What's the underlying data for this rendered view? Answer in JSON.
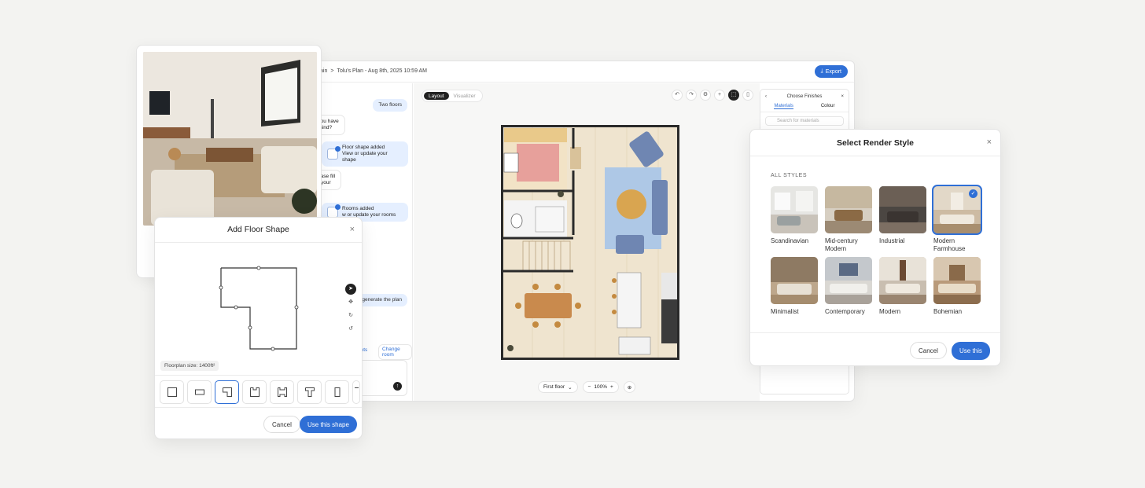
{
  "app": {
    "breadcrumb": [
      "ain",
      ">",
      "Tolu's Plan - Aug 8th, 2025 10:59 AM"
    ],
    "export_label": "Export",
    "chat": {
      "messages": [
        {
          "role": "user",
          "text": "Two floors"
        },
        {
          "role": "ai",
          "text": "o you have\ne mind?"
        },
        {
          "role": "card",
          "title": "Floor shape added",
          "subtitle": "View or update your shape"
        },
        {
          "role": "ai",
          "text": "please fill\ndd your"
        },
        {
          "role": "card",
          "title": "Rooms added",
          "subtitle": "w or update your rooms"
        },
        {
          "role": "user",
          "text": "generate the plan"
        }
      ],
      "link_left": "ents",
      "link_right": "Change room"
    },
    "canvas": {
      "modes": [
        "Layout",
        "Visualizer"
      ],
      "floor_select": "First floor",
      "zoom": "100%"
    },
    "finishes": {
      "title": "Choose Finishes",
      "tabs": [
        "Materials",
        "Colour"
      ],
      "search_placeholder": "Search for materials"
    }
  },
  "shape_dialog": {
    "title": "Add Floor Shape",
    "floorplan_size": "Floorplan size: 1400ft²",
    "cancel_label": "Cancel",
    "confirm_label": "Use this shape"
  },
  "render_dialog": {
    "title": "Select Render Style",
    "section": "ALL STYLES",
    "styles": [
      {
        "label": "Scandinavian",
        "selected": false
      },
      {
        "label": "Mid-century Modern",
        "selected": false
      },
      {
        "label": "Industrial",
        "selected": false
      },
      {
        "label": "Modern Farmhouse",
        "selected": true
      },
      {
        "label": "Minimalist",
        "selected": false
      },
      {
        "label": "Contemporary",
        "selected": false
      },
      {
        "label": "Modern",
        "selected": false
      },
      {
        "label": "Bohemian",
        "selected": false
      }
    ],
    "cancel_label": "Cancel",
    "confirm_label": "Use this"
  },
  "colors": {
    "accent": "#2f6fd6",
    "background": "#f3f3f1"
  }
}
